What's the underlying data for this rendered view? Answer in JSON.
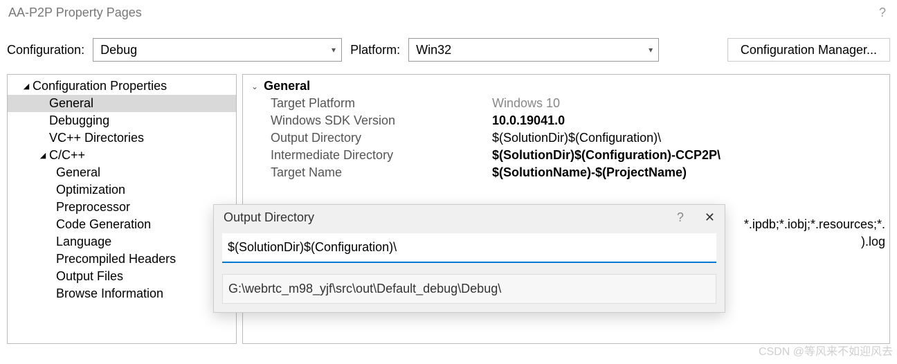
{
  "titlebar": {
    "title": "AA-P2P Property Pages",
    "help": "?"
  },
  "toolbar": {
    "config_label": "Configuration:",
    "config_value": "Debug",
    "platform_label": "Platform:",
    "platform_value": "Win32",
    "manager_label": "Configuration Manager..."
  },
  "tree": {
    "root": "Configuration Properties",
    "items": [
      "General",
      "Debugging",
      "VC++ Directories"
    ],
    "cpp": "C/C++",
    "cpp_children": [
      "General",
      "Optimization",
      "Preprocessor",
      "Code Generation",
      "Language",
      "Precompiled Headers",
      "Output Files",
      "Browse Information"
    ]
  },
  "props": {
    "section": "General",
    "rows": [
      {
        "label": "Target Platform",
        "value": "Windows 10"
      },
      {
        "label": "Windows SDK Version",
        "value": "10.0.19041.0"
      },
      {
        "label": "Output Directory",
        "value": "$(SolutionDir)$(Configuration)\\"
      },
      {
        "label": "Intermediate Directory",
        "value": "$(SolutionDir)$(Configuration)-CCP2P\\"
      },
      {
        "label": "Target Name",
        "value": "$(SolutionName)-$(ProjectName)"
      }
    ],
    "frag1": "*.ipdb;*.iobj;*.resources;*.",
    "frag2": ").log"
  },
  "popup": {
    "title": "Output Directory",
    "help": "?",
    "close": "✕",
    "input": "$(SolutionDir)$(Configuration)\\",
    "evaluated": "G:\\webrtc_m98_yjf\\src\\out\\Default_debug\\Debug\\"
  },
  "watermark": "CSDN @等风来不如迎风去"
}
